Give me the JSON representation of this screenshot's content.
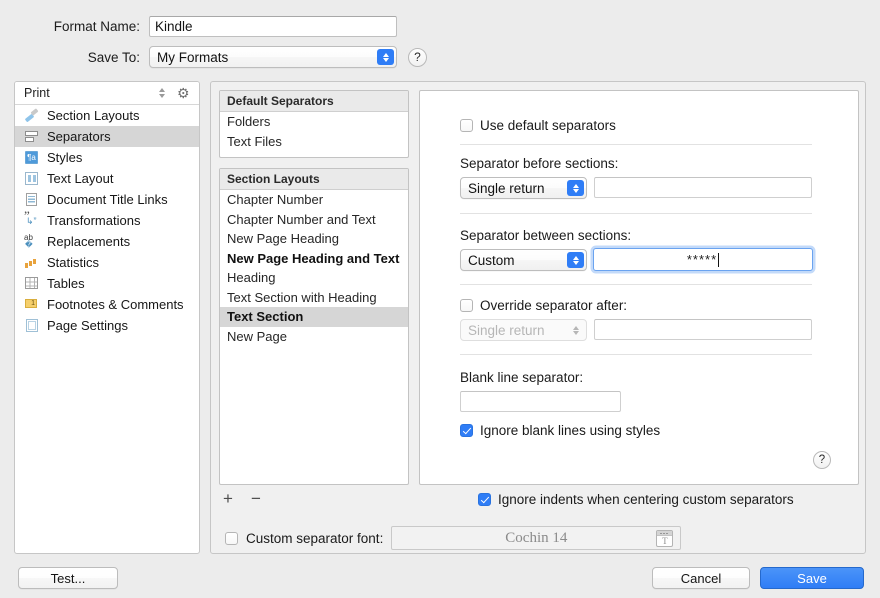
{
  "top": {
    "format_name_label": "Format Name:",
    "format_name_value": "Kindle",
    "save_to_label": "Save To:",
    "save_to_value": "My Formats",
    "help_glyph": "?"
  },
  "sidebar": {
    "header_title": "Print",
    "items": [
      {
        "label": "Section Layouts",
        "icon": "brush-icon",
        "selected": false
      },
      {
        "label": "Separators",
        "icon": "separators-icon",
        "selected": true
      },
      {
        "label": "Styles",
        "icon": "styles-icon",
        "selected": false
      },
      {
        "label": "Text Layout",
        "icon": "text-layout-icon",
        "selected": false
      },
      {
        "label": "Document Title Links",
        "icon": "document-links-icon",
        "selected": false
      },
      {
        "label": "Transformations",
        "icon": "transformations-icon",
        "selected": false
      },
      {
        "label": "Replacements",
        "icon": "replacements-icon",
        "selected": false
      },
      {
        "label": "Statistics",
        "icon": "statistics-icon",
        "selected": false
      },
      {
        "label": "Tables",
        "icon": "tables-icon",
        "selected": false
      },
      {
        "label": "Footnotes & Comments",
        "icon": "footnotes-icon",
        "selected": false
      },
      {
        "label": "Page Settings",
        "icon": "page-settings-icon",
        "selected": false
      }
    ]
  },
  "default_separators": {
    "header": "Default Separators",
    "rows": [
      {
        "label": "Folders",
        "selected": false,
        "bold": false
      },
      {
        "label": "Text Files",
        "selected": false,
        "bold": false
      }
    ]
  },
  "section_layouts": {
    "header": "Section Layouts",
    "rows": [
      {
        "label": "Chapter Number",
        "selected": false,
        "bold": false
      },
      {
        "label": "Chapter Number and Text",
        "selected": false,
        "bold": false
      },
      {
        "label": "New Page Heading",
        "selected": false,
        "bold": false
      },
      {
        "label": "New Page Heading and Text",
        "selected": false,
        "bold": true
      },
      {
        "label": "Heading",
        "selected": false,
        "bold": false
      },
      {
        "label": "Text Section with Heading",
        "selected": false,
        "bold": false
      },
      {
        "label": "Text Section",
        "selected": true,
        "bold": true
      },
      {
        "label": "New Page",
        "selected": false,
        "bold": false
      }
    ],
    "add_button": "+",
    "remove_button": "−"
  },
  "options": {
    "use_default_separators": {
      "label": "Use default separators",
      "checked": false
    },
    "separator_before": {
      "label": "Separator before sections:",
      "popup_value": "Single return",
      "field_value": ""
    },
    "separator_between": {
      "label": "Separator between sections:",
      "popup_value": "Custom",
      "field_value": "*****"
    },
    "override_after": {
      "label": "Override separator after:",
      "checked": false,
      "popup_value": "Single return",
      "field_value": "",
      "disabled": true
    },
    "blank_line_separator": {
      "label": "Blank line separator:",
      "field_value": ""
    },
    "ignore_blank_lines": {
      "label": "Ignore blank lines using styles",
      "checked": true
    },
    "panel_help_glyph": "?"
  },
  "bottom_options": {
    "ignore_indents": {
      "label": "Ignore indents when centering custom separators",
      "checked": true
    },
    "custom_separator_font": {
      "label": "Custom separator font:",
      "checked": false,
      "value": "Cochin 14"
    }
  },
  "buttons": {
    "test": "Test...",
    "cancel": "Cancel",
    "save": "Save"
  },
  "colors": {
    "accent_blue": "#2f7df6",
    "selection_grey": "#d6d6d6",
    "window_background": "#ececec",
    "focus_ring": "#6aa3f0"
  }
}
